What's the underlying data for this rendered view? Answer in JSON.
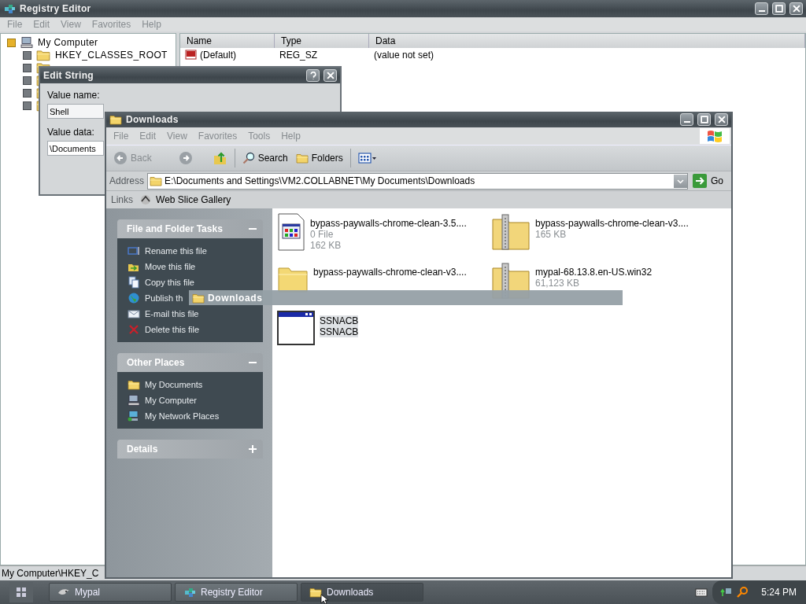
{
  "registry_editor": {
    "title": "Registry Editor",
    "menu": [
      {
        "label": "File",
        "disabled": true
      },
      {
        "label": "Edit",
        "disabled": true
      },
      {
        "label": "View",
        "disabled": true
      },
      {
        "label": "Favorites",
        "disabled": true
      },
      {
        "label": "Help",
        "disabled": true
      }
    ],
    "tree": {
      "label": "My Computer",
      "expanded": true,
      "children": [
        {
          "label": "HKEY_CLASSES_ROOT",
          "expanded": false
        },
        {
          "expanded": false
        },
        {
          "expanded": false
        },
        {
          "expanded": false
        },
        {
          "expanded": false
        }
      ]
    },
    "columns": [
      "Name",
      "Type",
      "Data"
    ],
    "rows": [
      {
        "name": "(Default)",
        "type": "REG_SZ",
        "data": "(value not set)"
      }
    ],
    "status_bar": "My Computer\\HKEY_C"
  },
  "edit_string": {
    "title": "Edit String",
    "value_name_label": "Value name:",
    "value_name": "Shell",
    "value_data_label": "Value data:",
    "value_data": "\\Documents"
  },
  "downloads": {
    "title": "Downloads",
    "menu": [
      {
        "label": "File",
        "disabled": true
      },
      {
        "label": "Edit",
        "disabled": true
      },
      {
        "label": "View",
        "disabled": true
      },
      {
        "label": "Favorites",
        "disabled": true
      },
      {
        "label": "Tools",
        "disabled": true
      },
      {
        "label": "Help",
        "disabled": true
      }
    ],
    "toolbar": [
      {
        "kind": "back",
        "label": "Back",
        "disabled": true
      },
      {
        "kind": "forward"
      },
      {
        "kind": "up"
      },
      {
        "kind": "search",
        "label": "Search"
      },
      {
        "kind": "folders",
        "label": "Folders"
      },
      {
        "kind": "views"
      }
    ],
    "address_label": "Address",
    "address": "E:\\Documents and Settings\\VM2.COLLABNET\\My Documents\\Downloads",
    "go_label": "Go",
    "links_label": "Links",
    "links": [
      {
        "label": "Web Slice Gallery"
      }
    ],
    "task_groups": [
      {
        "title": "File and Folder Tasks",
        "expanded": true,
        "items": [
          {
            "kind": "rename",
            "label": "Rename this file"
          },
          {
            "kind": "move",
            "label": "Move this file"
          },
          {
            "kind": "copy",
            "label": "Copy this file"
          },
          {
            "kind": "publish",
            "label": "Publish th"
          },
          {
            "kind": "email",
            "label": "E-mail this file"
          },
          {
            "kind": "delete",
            "label": "Delete this file"
          }
        ]
      },
      {
        "title": "Other Places",
        "expanded": true,
        "items": [
          {
            "kind": "documents",
            "label": "My Documents"
          },
          {
            "kind": "computer",
            "label": "My Computer"
          },
          {
            "kind": "network",
            "label": "My Network Places"
          }
        ]
      },
      {
        "title": "Details",
        "expanded": false
      }
    ],
    "files": [
      {
        "kind": "document",
        "name": "bypass-paywalls-chrome-clean-3.5....",
        "details": [
          "0 File",
          "162 KB"
        ],
        "selected": false
      },
      {
        "kind": "zip",
        "name": "bypass-paywalls-chrome-clean-v3....",
        "details": [
          "165 KB"
        ],
        "selected": false
      },
      {
        "kind": "folder",
        "name": "bypass-paywalls-chrome-clean-v3....",
        "selected": false
      },
      {
        "kind": "zip",
        "name": "mypal-68.13.8.en-US.win32",
        "details": [
          "61,123 KB"
        ],
        "selected": false
      },
      {
        "kind": "app",
        "name": "SSNACB",
        "details": [
          "SSNACB"
        ],
        "selected": true
      }
    ],
    "drag_label": "Downloads"
  },
  "taskbar": {
    "buttons": [
      {
        "kind": "mypal",
        "label": "Mypal",
        "selected": false
      },
      {
        "kind": "regedit",
        "label": "Registry Editor",
        "selected": false
      },
      {
        "kind": "folder",
        "label": "Downloads",
        "selected": true
      }
    ],
    "clock": "5:24 PM"
  }
}
